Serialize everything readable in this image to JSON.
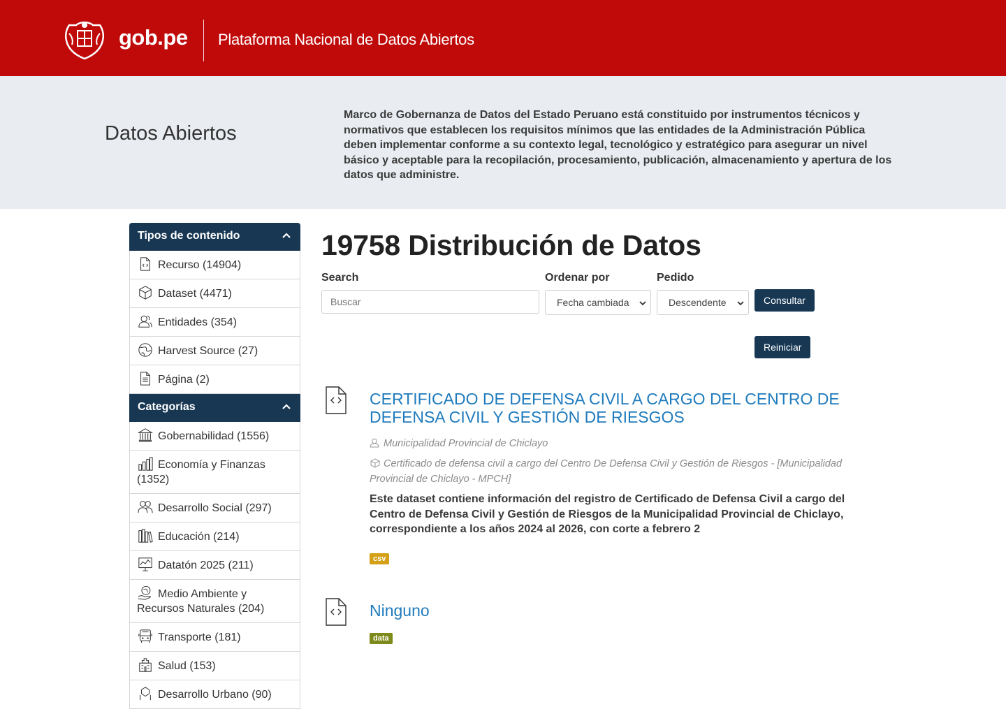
{
  "header": {
    "brand": "gob.pe",
    "platform": "Plataforma Nacional de Datos Abiertos"
  },
  "hero": {
    "title": "Datos Abiertos",
    "description": "Marco de Gobernanza de Datos del Estado Peruano está constituido por instrumentos técnicos y normativos que establecen los requisitos mínimos que las entidades de la Administración Pública deben implementar conforme a su contexto legal, tecnológico y estratégico para asegurar un nivel básico y aceptable para la recopilación, procesamiento, publicación, almacenamiento y apertura de los datos que administre."
  },
  "sidebar": {
    "content_types": {
      "title": "Tipos de contenido",
      "items": [
        {
          "label": "Recurso (14904)",
          "icon": "file-code-icon"
        },
        {
          "label": "Dataset (4471)",
          "icon": "cube-icon"
        },
        {
          "label": "Entidades (354)",
          "icon": "users-icon"
        },
        {
          "label": "Harvest Source (27)",
          "icon": "globe-icon"
        },
        {
          "label": "Página (2)",
          "icon": "page-icon"
        }
      ]
    },
    "categories": {
      "title": "Categorías",
      "items": [
        {
          "label": "Gobernabilidad (1556)",
          "icon": "institution-icon"
        },
        {
          "label": "Economía y Finanzas (1352)",
          "icon": "coins-icon"
        },
        {
          "label": "Desarrollo Social (297)",
          "icon": "people-icon"
        },
        {
          "label": "Educación (214)",
          "icon": "books-icon"
        },
        {
          "label": "Datatón 2025 (211)",
          "icon": "chart-board-icon"
        },
        {
          "label": "Medio Ambiente y Recursos Naturales (204)",
          "icon": "earth-hand-icon"
        },
        {
          "label": "Transporte (181)",
          "icon": "bus-icon"
        },
        {
          "label": "Salud (153)",
          "icon": "hospital-icon"
        },
        {
          "label": "Desarrollo Urbano (90)",
          "icon": "urban-icon"
        }
      ]
    }
  },
  "main": {
    "count_title": "19758 Distribución de Datos",
    "search_label": "Search",
    "search_placeholder": "Buscar",
    "sort_label": "Ordenar por",
    "sort_value": "Fecha cambiada",
    "order_label": "Pedido",
    "order_value": "Descendente",
    "submit_label": "Consultar",
    "reset_label": "Reiniciar"
  },
  "results": [
    {
      "title": "CERTIFICADO DE DEFENSA CIVIL A CARGO DEL CENTRO DE DEFENSA CIVIL Y GESTIÓN DE RIESGOS",
      "organization": "Municipalidad Provincial de Chiclayo",
      "dataset": "Certificado de defensa civil a cargo del Centro De Defensa Civil y Gestión de Riesgos - [Municipalidad Provincial de Chiclayo - MPCH]",
      "description": "Este dataset contiene información del registro de Certificado de Defensa Civil a cargo del Centro de Defensa Civil y Gestión de Riesgos de la Municipalidad Provincial de Chiclayo, correspondiente a los años 2024 al 2026, con corte a febrero 2",
      "format": "csv",
      "format_color": "#d4a017"
    },
    {
      "title": "Ninguno",
      "format": "data",
      "format_color": "#7d8a1a"
    }
  ],
  "colors": {
    "header_red": "#c00a0a",
    "navy": "#173753",
    "link_blue": "#1f7bbd"
  }
}
